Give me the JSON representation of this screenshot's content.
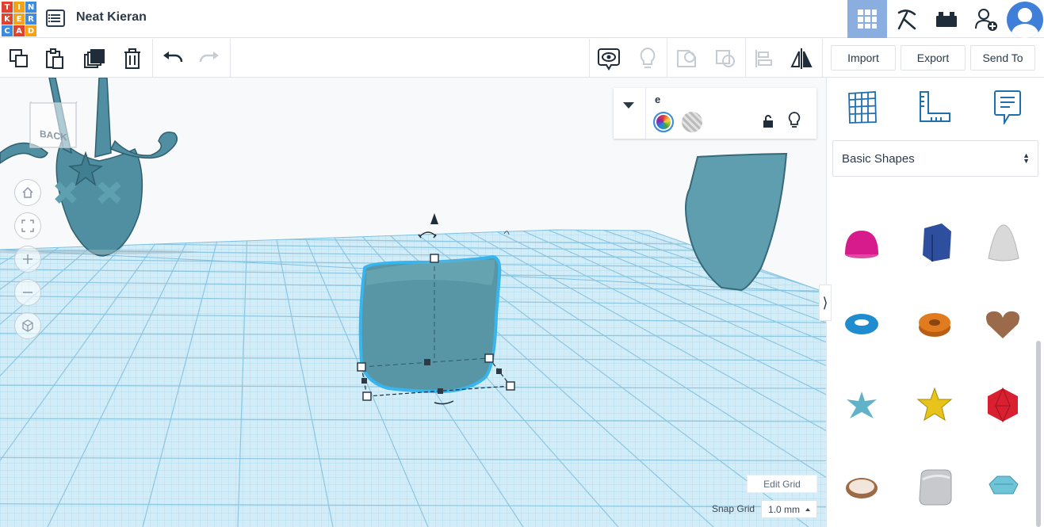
{
  "app": {
    "logo_letters": [
      "T",
      "I",
      "N",
      "K",
      "E",
      "R",
      "C",
      "A",
      "D"
    ],
    "logo_colors": [
      "#e2412e",
      "#f4a21a",
      "#3c8be0",
      "#e2412e",
      "#f4a21a",
      "#3c8be0",
      "#3c8be0",
      "#e2412e",
      "#f4a21a"
    ],
    "project_title": "Neat Kieran"
  },
  "topbar": {
    "icons": [
      "grid-view-icon",
      "pickaxe-icon",
      "bricks-icon",
      "add-user-icon",
      "user-avatar-icon"
    ],
    "active_view": "grid-view-icon"
  },
  "toolbar": {
    "left_tools": [
      "copy-icon",
      "paste-icon",
      "duplicate-icon",
      "delete-icon",
      "undo-icon",
      "redo-icon"
    ],
    "right_tools": [
      "show-notes-icon",
      "toggle-visibility-icon",
      "group-icon",
      "ungroup-icon",
      "align-icon",
      "mirror-icon"
    ],
    "import_label": "Import",
    "export_label": "Export",
    "sendto_label": "Send To"
  },
  "workplane": {
    "viewcube_label": "BACK",
    "nav_buttons": [
      "home-view-icon",
      "fit-view-icon",
      "zoom-in-icon",
      "zoom-out-icon",
      "perspective-icon"
    ],
    "inspector": {
      "shape_name": "e",
      "solid_label": "",
      "hole_label": ""
    },
    "edit_grid_label": "Edit Grid",
    "snap_grid_label": "Snap Grid",
    "snap_grid_value": "1.0 mm",
    "colors": {
      "grid_line": "#a9d9ef",
      "grid_fill": "#cdeaf7",
      "shape_fill": "#5a99a8",
      "shape_selected_outline": "#38b6f0"
    }
  },
  "panel": {
    "tools": [
      "workplane-icon",
      "ruler-icon",
      "notes-icon"
    ],
    "library_label": "Basic Shapes",
    "shapes": [
      {
        "name": "half-sphere",
        "color": "#d81b8c"
      },
      {
        "name": "polygon",
        "color": "#2e4f9e"
      },
      {
        "name": "paraboloid",
        "color": "#d9d9d9"
      },
      {
        "name": "torus",
        "color": "#1e8ccf"
      },
      {
        "name": "tube",
        "color": "#e07b1f"
      },
      {
        "name": "heart",
        "color": "#9a6a4a"
      },
      {
        "name": "star",
        "color": "#5fb2c7"
      },
      {
        "name": "star-yellow",
        "color": "#e8c31a"
      },
      {
        "name": "icosahedron",
        "color": "#d92030"
      },
      {
        "name": "ring",
        "color": "#9c6b45"
      },
      {
        "name": "rounded-box",
        "color": "#c7c9cc"
      },
      {
        "name": "gem",
        "color": "#6fc4d8"
      }
    ]
  }
}
